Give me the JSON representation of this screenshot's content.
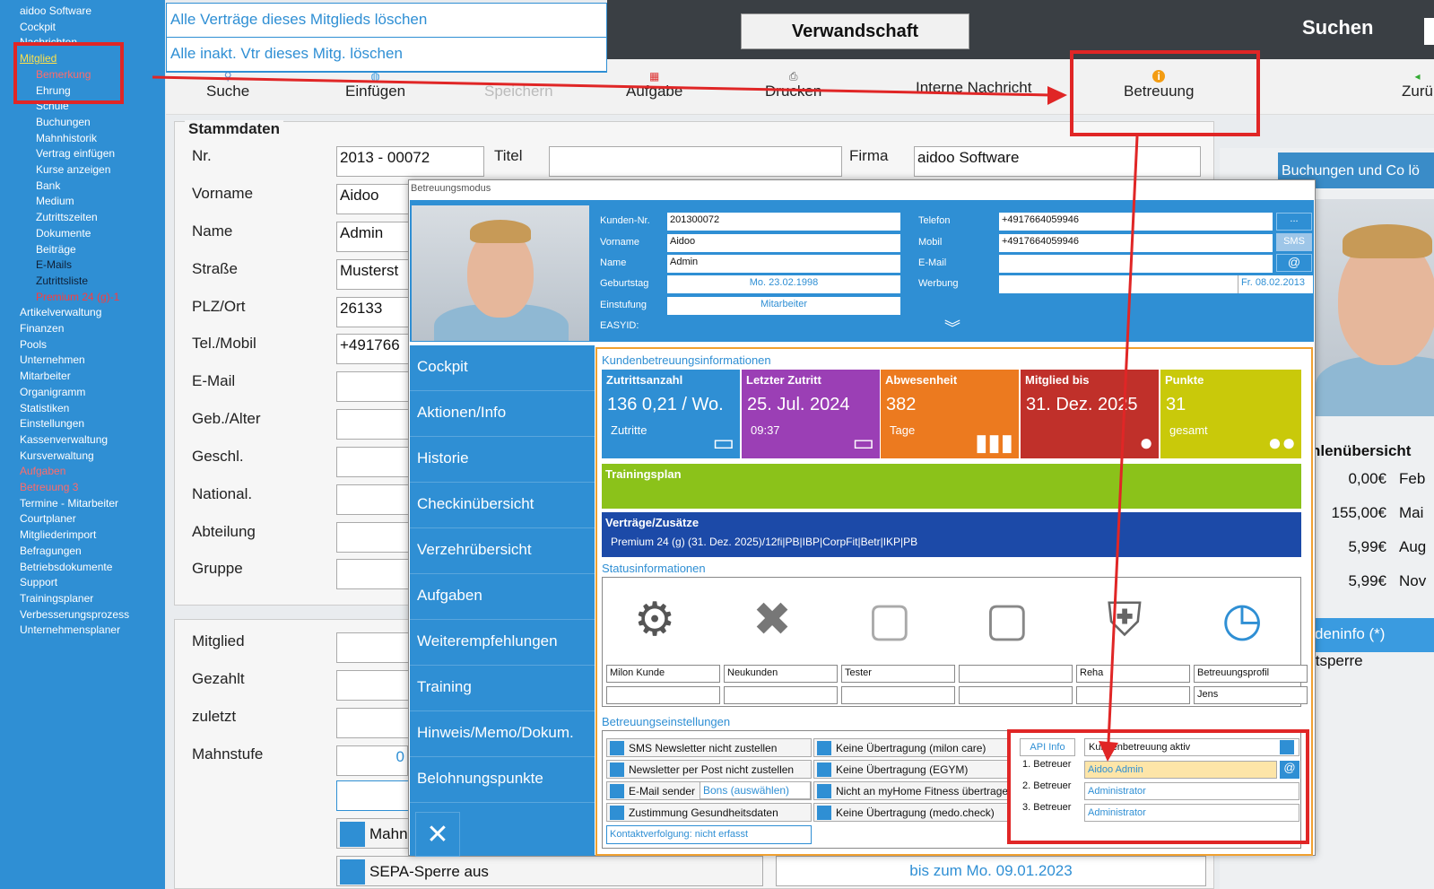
{
  "sidebar": {
    "items": [
      {
        "label": "aidoo Software",
        "style": "white"
      },
      {
        "label": "Cockpit",
        "style": "white"
      },
      {
        "label": "Nachrichten",
        "style": "white"
      },
      {
        "label": "Mitglied",
        "style": "yellow"
      },
      {
        "label": "Bemerkung",
        "style": "red"
      },
      {
        "label": "Ehrung",
        "style": "white"
      },
      {
        "label": "Schule",
        "style": "white"
      },
      {
        "label": "Buchungen",
        "style": "white"
      },
      {
        "label": "Mahnhistorik",
        "style": "white"
      },
      {
        "label": "Vertrag einfügen",
        "style": "white"
      },
      {
        "label": "Kurse anzeigen",
        "style": "white"
      },
      {
        "label": "Bank",
        "style": "white"
      },
      {
        "label": "Medium",
        "style": "white"
      },
      {
        "label": "Zutrittszeiten",
        "style": "white"
      },
      {
        "label": "Dokumente",
        "style": "white"
      },
      {
        "label": "Beiträge",
        "style": "white"
      },
      {
        "label": "E-Mails",
        "style": "dark"
      },
      {
        "label": "Zutrittsliste",
        "style": "dark"
      },
      {
        "label": "Premium 24 (g)-1",
        "style": "red2"
      },
      {
        "label": "Artikelverwaltung",
        "style": "white"
      },
      {
        "label": "Finanzen",
        "style": "white"
      },
      {
        "label": "Pools",
        "style": "white"
      },
      {
        "label": "Unternehmen",
        "style": "white"
      },
      {
        "label": "Mitarbeiter",
        "style": "white"
      },
      {
        "label": "Organigramm",
        "style": "white"
      },
      {
        "label": "Statistiken",
        "style": "white"
      },
      {
        "label": "Einstellungen",
        "style": "white"
      },
      {
        "label": "Kassenverwaltung",
        "style": "white"
      },
      {
        "label": "Kursverwaltung",
        "style": "white"
      },
      {
        "label": "Aufgaben",
        "style": "red"
      },
      {
        "label": "Betreuung 3",
        "style": "red"
      },
      {
        "label": "Termine - Mitarbeiter",
        "style": "white"
      },
      {
        "label": "Courtplaner",
        "style": "white"
      },
      {
        "label": "Mitgliederimport",
        "style": "white"
      },
      {
        "label": "Befragungen",
        "style": "white"
      },
      {
        "label": "Betriebsdokumente",
        "style": "white"
      },
      {
        "label": "Support",
        "style": "white"
      },
      {
        "label": "Trainingsplaner",
        "style": "white"
      },
      {
        "label": "Verbesserungsprozess",
        "style": "white"
      },
      {
        "label": "Unternehmensplaner",
        "style": "white"
      }
    ]
  },
  "dropdown": {
    "items": [
      "Alle Verträge dieses Mitglieds löschen",
      "Alle inakt. Vtr dieses Mitg. löschen"
    ]
  },
  "topbar": {
    "verwandschaft": "Verwandschaft",
    "suchen": "Suchen"
  },
  "toolbar": {
    "suche": "Suche",
    "einfuegen": "Einfügen",
    "speichern": "Speichern",
    "aufgabe": "Aufgabe",
    "drucken": "Drucken",
    "interne": "Interne Nachricht",
    "betreuung": "Betreuung",
    "zurueck": "Zurü"
  },
  "form": {
    "section": "Stammdaten",
    "labels": {
      "nr": "Nr.",
      "titel": "Titel",
      "firma": "Firma",
      "vorname": "Vorname",
      "name": "Name",
      "strasse": "Straße",
      "plz": "PLZ/Ort",
      "tel": "Tel./Mobil",
      "email": "E-Mail",
      "geb": "Geb./Alter",
      "geschl": "Geschl.",
      "national": "National.",
      "abteilung": "Abteilung",
      "gruppe": "Gruppe",
      "mitglied": "Mitglied",
      "gezahlt": "Gezahlt",
      "zuletzt": "zuletzt",
      "mahnstufe": "Mahnstufe"
    },
    "values": {
      "nr": "2013 - 00072",
      "firma": "aidoo Software",
      "vorname": "Aidoo",
      "name": "Admin",
      "strasse": "Musterst",
      "plz": "26133",
      "tel": "+491766",
      "mahnstufe": "0"
    },
    "mahn": "Mahn",
    "sepa": "SEPA-Sperre aus",
    "bis": "bis zum Mo. 09.01.2023"
  },
  "right": {
    "buchungen": "Buchungen und Co lö",
    "zahlen": "hlenübersicht",
    "rows": [
      [
        "0,00€",
        "Feb"
      ],
      [
        "155,00€",
        "Mai"
      ],
      [
        "5,99€",
        "Aug"
      ],
      [
        "5,99€",
        "Nov"
      ]
    ],
    "deninfo": "deninfo (*)",
    "ttsperre": "ttsperre"
  },
  "modal": {
    "title": "Betreuungsmodus",
    "header": {
      "kundennr_l": "Kunden-Nr.",
      "kundennr": "201300072",
      "vorname_l": "Vorname",
      "vorname": "Aidoo",
      "name_l": "Name",
      "name": "Admin",
      "geb_l": "Geburtstag",
      "geb": "Mo. 23.02.1998",
      "einst_l": "Einstufung",
      "einst": "Mitarbeiter",
      "easy_l": "EASYID:",
      "tel_l": "Telefon",
      "tel": "+4917664059946",
      "mobil_l": "Mobil",
      "mobil": "+4917664059946",
      "email_l": "E-Mail",
      "email": "",
      "werbung_l": "Werbung",
      "werbung_date": "Fr. 08.02.2013",
      "dots": "...",
      "sms": "SMS",
      "at": "@"
    },
    "nav": [
      "Cockpit",
      "Aktionen/Info",
      "Historie",
      "Checkinübersicht",
      "Verzehrübersicht",
      "Aufgaben",
      "Weiterempfehlungen",
      "Training",
      "Hinweis/Memo/Dokum.",
      "Belohnungspunkte"
    ],
    "close": "✕",
    "kbi": "Kundenbetreuungsinformationen",
    "tiles": [
      {
        "title": "Zutrittsanzahl",
        "value": "136 0,21 / Wo.",
        "sub": "Zutritte",
        "color": "#2f8fd4"
      },
      {
        "title": "Letzter Zutritt",
        "value": "25. Jul. 2024",
        "sub": "09:37",
        "color": "#9b3fb5"
      },
      {
        "title": "Abwesenheit",
        "value": "382",
        "sub": "Tage",
        "color": "#ec7a1f"
      },
      {
        "title": "Mitglied bis",
        "value": "31. Dez. 2025",
        "sub": "",
        "color": "#c0302a"
      },
      {
        "title": "Punkte",
        "value": "31",
        "sub": "gesamt",
        "color": "#c9c90a"
      }
    ],
    "trainingsplan": "Trainingsplan",
    "vertraege_t": "Verträge/Zusätze",
    "vertraege": "Premium 24 (g) (31. Dez. 2025)/12fi|PB|IBP|CorpFit|Betr|IKP|PB",
    "status_t": "Statusinformationen",
    "status_labels": [
      "Milon Kunde",
      "Neukunden",
      "Tester",
      "",
      "Reha",
      "Betreuungsprofil"
    ],
    "status_values": [
      "",
      "",
      "",
      "",
      "",
      "Jens"
    ],
    "einst_t": "Betreuungseinstellungen",
    "checks_left": [
      "SMS Newsletter nicht zustellen",
      "Newsletter per Post nicht zustellen",
      "E-Mail sender",
      "Zustimmung Gesundheitsdaten"
    ],
    "bons": "Bons (auswählen)",
    "checks_mid": [
      "Keine Übertragung (milon care)",
      "Keine Übertragung (EGYM)",
      "Nicht an myHome Fitness übertragen",
      "Keine Übertragung (medo.check)"
    ],
    "kontakt": "Kontaktverfolgung: nicht erfasst",
    "api": "API Info",
    "kb_aktiv": "Kundenbetreuung aktiv",
    "betreuer_l": [
      "1. Betreuer",
      "2. Betreuer",
      "3. Betreuer"
    ],
    "betreuer": [
      "Aidoo Admin",
      "Administrator",
      "Administrator"
    ]
  },
  "colors": {
    "accent": "#2f8fd4",
    "annotation": "#e02626"
  }
}
